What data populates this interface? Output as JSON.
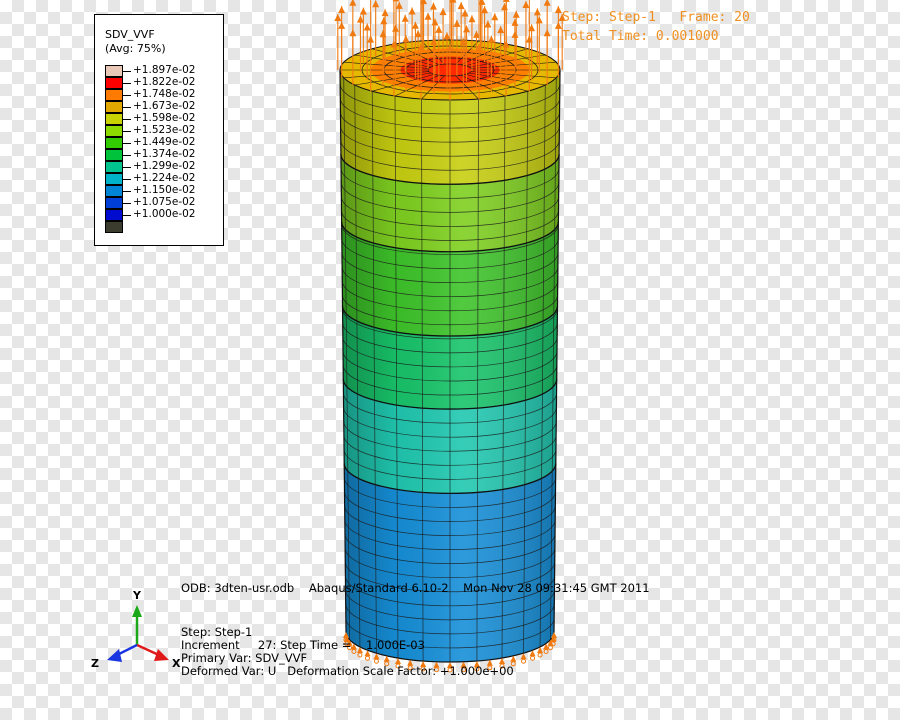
{
  "legend": {
    "title": "SDV_VVF",
    "subtitle": "(Avg: 75%)",
    "entries": [
      {
        "value": "+1.897e-02",
        "color": "#e9c7b7"
      },
      {
        "value": "+1.822e-02",
        "color": "#ff0000"
      },
      {
        "value": "+1.748e-02",
        "color": "#ff7a00"
      },
      {
        "value": "+1.673e-02",
        "color": "#e3a800"
      },
      {
        "value": "+1.598e-02",
        "color": "#c8d300"
      },
      {
        "value": "+1.523e-02",
        "color": "#8edb00"
      },
      {
        "value": "+1.449e-02",
        "color": "#33cc00"
      },
      {
        "value": "+1.374e-02",
        "color": "#00c23b"
      },
      {
        "value": "+1.299e-02",
        "color": "#00c48f"
      },
      {
        "value": "+1.224e-02",
        "color": "#00b3c8"
      },
      {
        "value": "+1.150e-02",
        "color": "#0085d6"
      },
      {
        "value": "+1.075e-02",
        "color": "#0040d8"
      },
      {
        "value": "+1.000e-02",
        "color": "#000bd0"
      },
      {
        "value": "",
        "color": "#3c3c2e"
      }
    ]
  },
  "step_info": {
    "line1": "Step: Step-1   Frame: 20",
    "line2": "Total Time: 0.001000"
  },
  "odb_info": {
    "odb": "ODB: 3dten-usr.odb    Abaqus/Standard 6.10-2    Mon Nov 28 09:31:45 GMT 2011",
    "step": "Step: Step-1",
    "increment": "Increment     27: Step Time =    1.000E-03",
    "primary": "Primary Var: SDV_VVF",
    "deformed": "Deformed Var: U   Deformation Scale Factor: +1.000e+00"
  },
  "triad": {
    "x": "X",
    "y": "Y",
    "z": "Z",
    "x_color": "#e01a1a",
    "y_color": "#1aa81a",
    "z_color": "#1a36e0"
  },
  "model": {
    "bands": [
      {
        "color": "#c8cf10",
        "from": 0.0,
        "to": 0.15
      },
      {
        "color": "#7fd020",
        "from": 0.15,
        "to": 0.27
      },
      {
        "color": "#3ec42a",
        "from": 0.27,
        "to": 0.42
      },
      {
        "color": "#18c46a",
        "from": 0.42,
        "to": 0.55
      },
      {
        "color": "#20c8b0",
        "from": 0.55,
        "to": 0.7
      },
      {
        "color": "#168fd8",
        "from": 0.7,
        "to": 1.0
      }
    ],
    "top_face_colors": [
      "#ff2a00",
      "#ff8000",
      "#e6b800"
    ],
    "load_arrow_color": "#f07a10"
  }
}
